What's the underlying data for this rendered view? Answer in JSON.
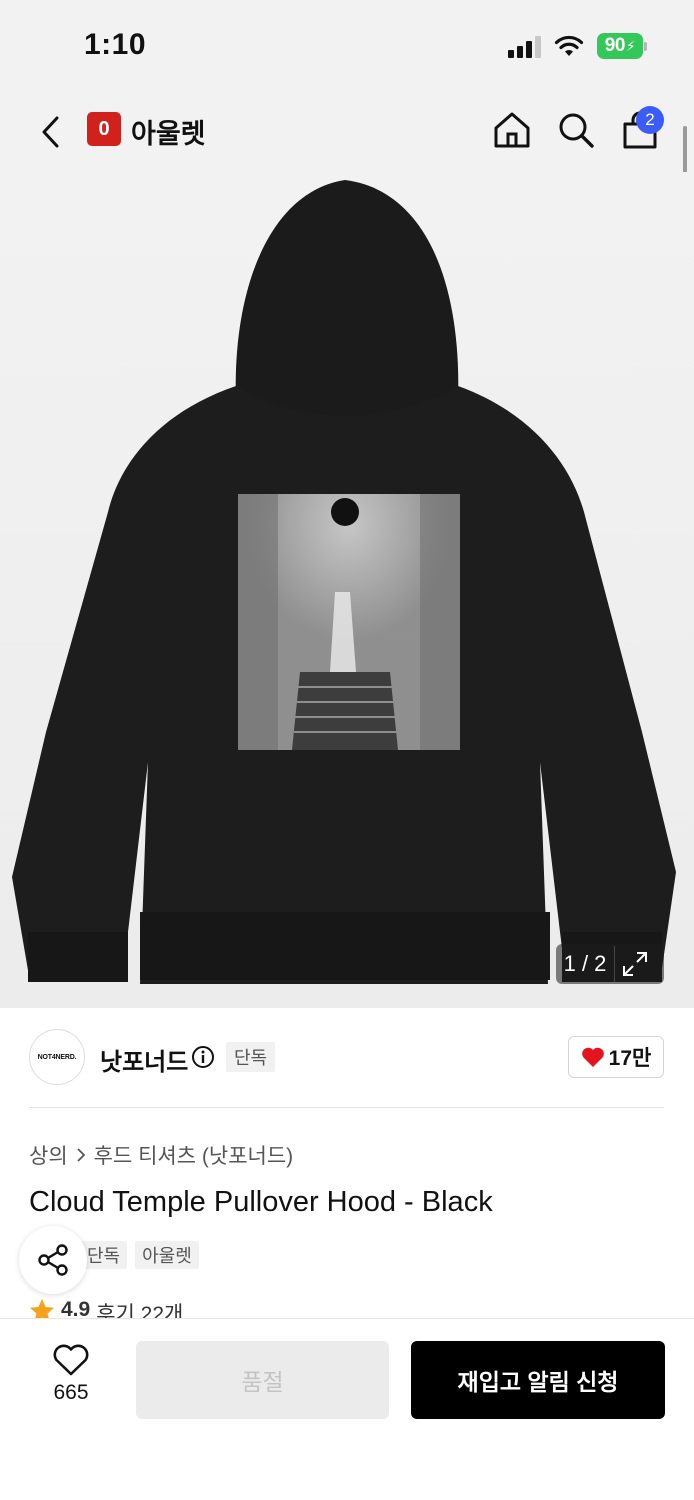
{
  "status_bar": {
    "time": "1:10",
    "battery": "90"
  },
  "nav": {
    "logo_letter": "0",
    "store_name": "아울렛",
    "cart_count": "2",
    "icons": [
      "chevron-left-icon",
      "home-icon",
      "search-icon",
      "shopping-bag-icon"
    ]
  },
  "gallery": {
    "counter": "1 / 2"
  },
  "brand": {
    "logo_text": "NOT4NERD.",
    "name": "낫포너드",
    "exclusive_tag": "단독",
    "like_count": "17만"
  },
  "product": {
    "breadcrumb": [
      "상의",
      "후드 티셔츠 (낫포너드)"
    ],
    "title": "Cloud Temple Pullover Hood - Black",
    "tags": [
      "단독",
      "아울렛"
    ],
    "rating": "4.9",
    "review_text": "후기 22개"
  },
  "bottom_bar": {
    "wish_count": "665",
    "soldout_label": "품절",
    "restock_label": "재입고 알림 신청"
  },
  "colors": {
    "brand_red": "#d1211c",
    "cart_badge": "#3b5cf6",
    "battery": "#34c759",
    "heart": "#e3141e",
    "star": "#f7a21b"
  }
}
